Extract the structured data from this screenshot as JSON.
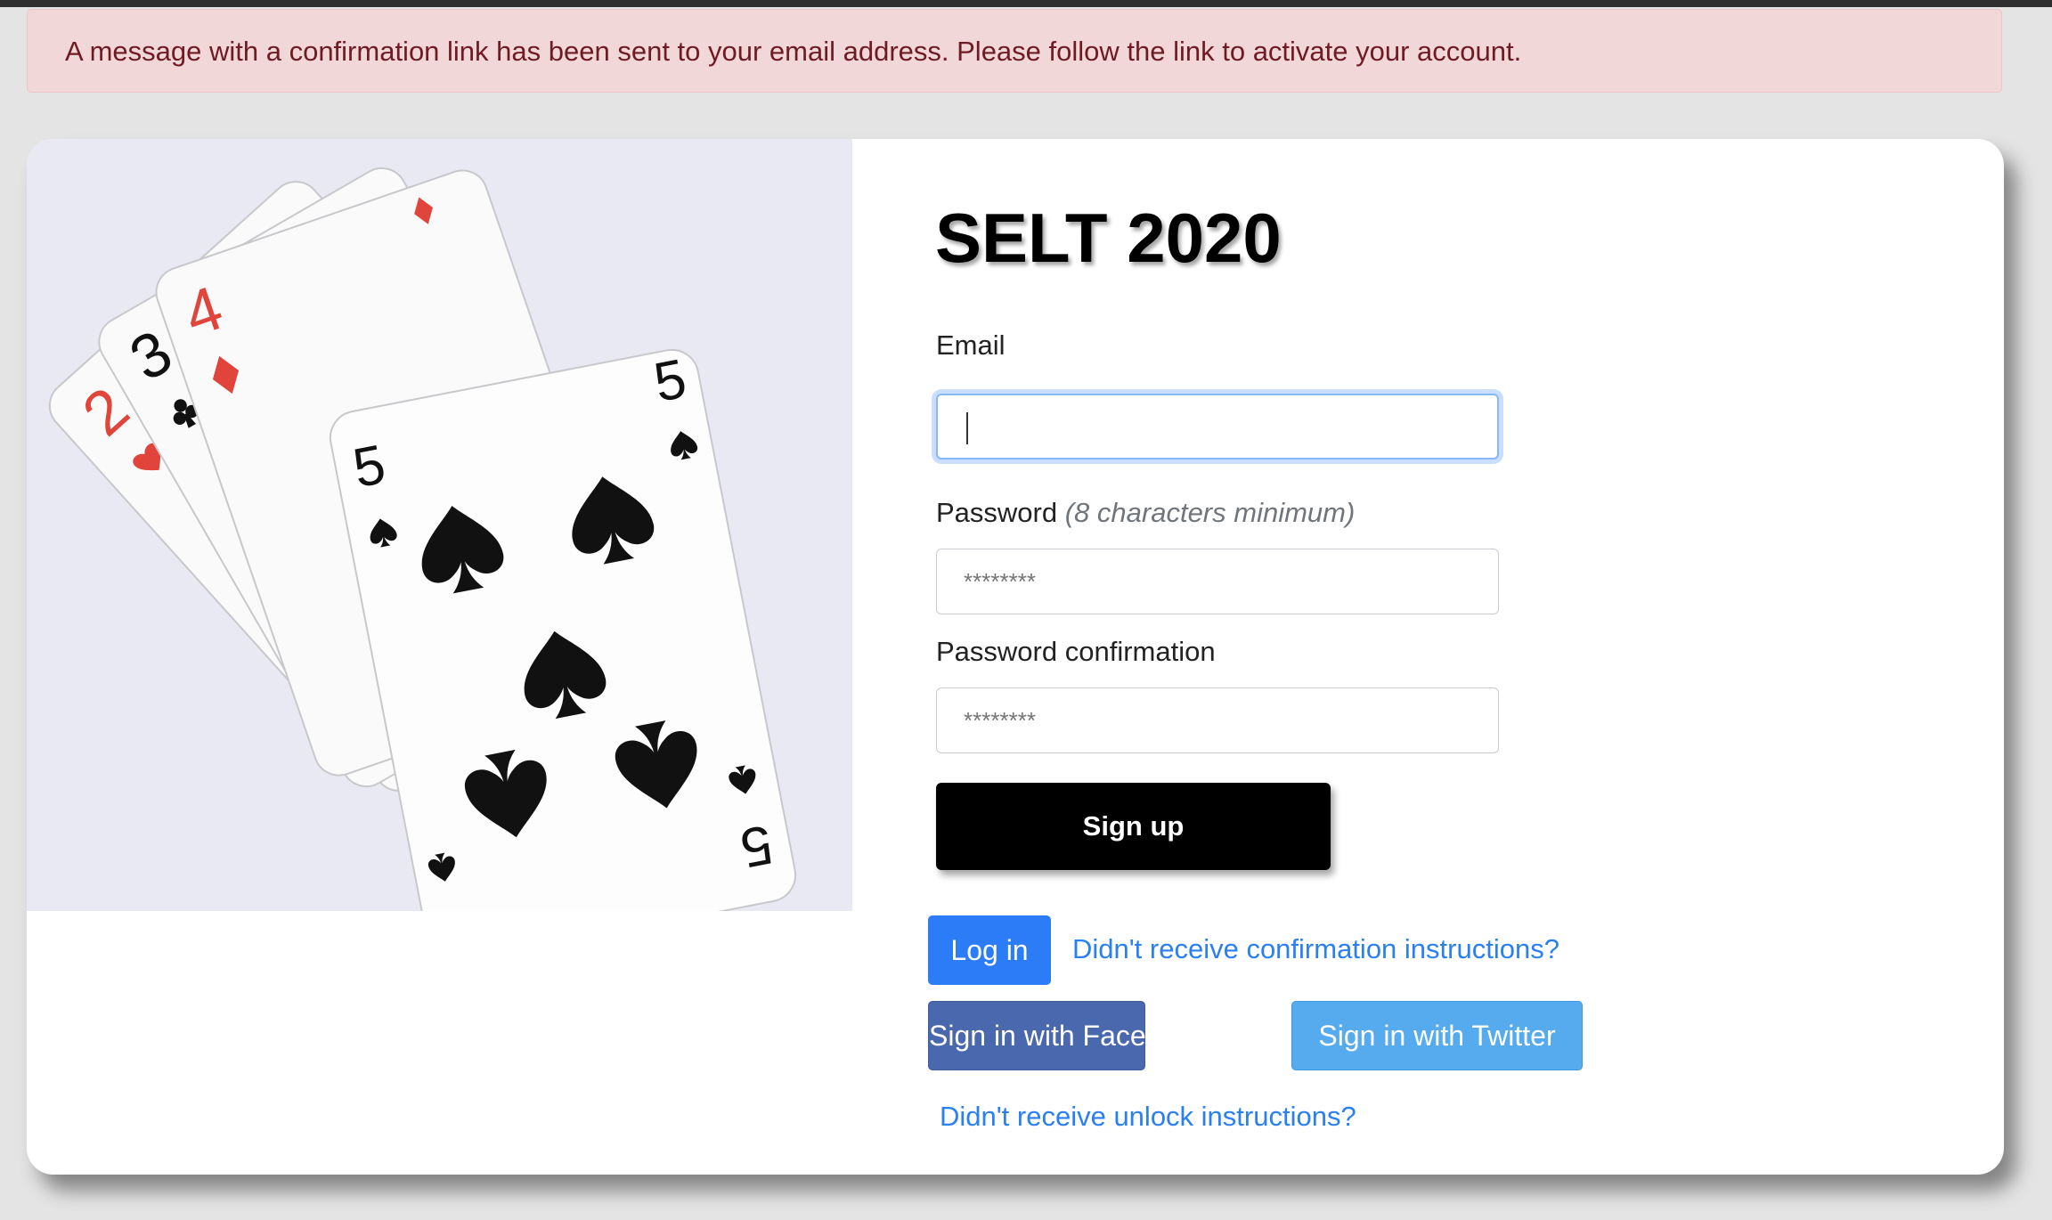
{
  "alert": {
    "message": "A message with a confirmation link has been sent to your email address. Please follow the link to activate your account."
  },
  "form": {
    "title": "SELT 2020",
    "email_label": "Email",
    "email_value": "",
    "password_label": "Password",
    "password_hint": "(8 characters minimum)",
    "password_placeholder": "********",
    "password_confirmation_label": "Password confirmation",
    "password_confirmation_placeholder": "********",
    "signup_label": "Sign up"
  },
  "links": {
    "login_label": "Log in",
    "confirmation_link": "Didn't receive confirmation instructions?",
    "facebook_label": "Sign in with Facebook",
    "twitter_label": "Sign in with Twitter",
    "unlock_link": "Didn't receive unlock instructions?"
  },
  "hero_cards": [
    {
      "rank": "2",
      "suit": "heart"
    },
    {
      "rank": "3",
      "suit": "club"
    },
    {
      "rank": "4",
      "suit": "diamond"
    },
    {
      "rank": "5",
      "suit": "spade"
    }
  ],
  "colors": {
    "alert_bg": "#f2d7d9",
    "alert_text": "#6e1b23",
    "primary": "#2b7cf6",
    "facebook": "#4a68ad",
    "twitter": "#55abee",
    "link": "#2a7ff3"
  }
}
